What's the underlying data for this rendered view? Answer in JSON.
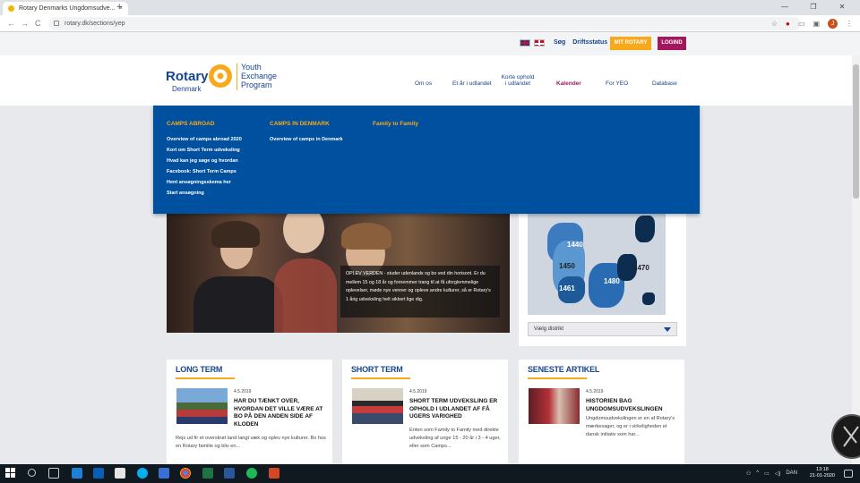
{
  "browser": {
    "tab_title": "Rotary Denmarks Ungdomsudve...",
    "tab_close": "×",
    "new_tab": "+",
    "url": "rotary.dk/sections/yep",
    "window_controls": [
      "—",
      "❐",
      "✕"
    ],
    "nav": [
      "←",
      "→",
      "C"
    ],
    "avatar_letter": "J"
  },
  "topbar": {
    "links": [
      "Søg",
      "Driftsstatus"
    ],
    "my_rotary": "MIT ROTARY",
    "login": "LOGIND"
  },
  "logo": {
    "rotary": "Rotary",
    "country": "Denmark",
    "program": [
      "Youth",
      "Exchange",
      "Program"
    ]
  },
  "nav": {
    "items": [
      {
        "label": "Om os"
      },
      {
        "label": "Et år i udlandet"
      },
      {
        "label": "Korte ophold i udlandet"
      },
      {
        "label": "Kalender"
      },
      {
        "label": "For YEO"
      },
      {
        "label": "Database"
      }
    ]
  },
  "mega_menu": {
    "columns": [
      {
        "heading": "CAMPS ABROAD",
        "links": [
          "Overview of camps abroad 2020",
          "Kort om Short Term udveksling",
          "Hvad kan jeg søge og hvordan",
          "Facebook: Short Term Camps",
          "Hent ansøgningsskema her",
          "Start ansøgning"
        ]
      },
      {
        "heading": "CAMPS IN DENMARK",
        "links": [
          "Overview of camps in Denmark"
        ]
      },
      {
        "heading": "Family to Family",
        "links": []
      }
    ]
  },
  "hero": {
    "caption": "OPLEV VERDEN - studer udenlands og bo ved din horisont. Er du mellem 15 og 18 år og fornemmer trang til at få uforglemmelige oplevelser, møde nye venner og opleve andre kulturer, så er Rotary's 1 årig udveksling helt sikkert lige dig."
  },
  "map": {
    "districts": [
      "1440",
      "1450",
      "1470",
      "1461",
      "1480"
    ],
    "select_label": "Vælg distrikt"
  },
  "cards": [
    {
      "heading": "LONG TERM",
      "date": "4.5.2019",
      "title": "HAR DU TÆNKT OVER, HVORDAN DET VILLE VÆRE AT BO PÅ DEN ANDEN SIDE AF KLODEN",
      "body": "Rejs ud fir et overskrøt land langt væk og oplev nye kulturer. Bo hos en Rotary familie og bliv en..."
    },
    {
      "heading": "SHORT TERM",
      "date": "4.5.2019",
      "title": "SHORT TERM UDVEKSLING ER OPHOLD I UDLANDET AF FÅ UGERS VARIGHED",
      "body": "Enten som Family to Family med direkte udveksling af unge 15 - 20 år i 3 - 4 uger, eller som Camps..."
    },
    {
      "heading": "SENESTE ARTIKEL",
      "date": "4.5.2019",
      "title": "HISTORIEN BAG UNGDOMSUDVEKSLINGEN",
      "body": "Ungdomsudvekslingen er en af Rotary's mærkesager, og er i virkeligheden et dansk initiativ som har..."
    }
  ],
  "taskbar": {
    "tray_text": "DAN",
    "time": "13:18",
    "date": "21-01-2020"
  }
}
